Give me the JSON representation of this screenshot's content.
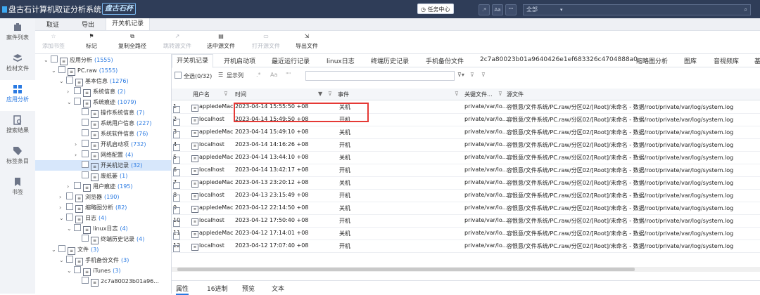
{
  "window": {
    "title": "盘古石计算机取证分析系统",
    "brand": "盘古石杯",
    "task_center": "任务中心",
    "regex_btn": ".*",
    "case_btn": "Aa",
    "word_btn": "\"\"",
    "scope": "全部",
    "search_icon": "search-icon"
  },
  "sidebar": {
    "items": [
      {
        "label": "案件列表",
        "icon": "case-icon"
      },
      {
        "label": "检材文件",
        "icon": "layers-icon"
      },
      {
        "label": "应用分析",
        "icon": "apps-icon",
        "active": true
      },
      {
        "label": "搜索结果",
        "icon": "search-result-icon"
      },
      {
        "label": "标签条目",
        "icon": "tag-icon"
      },
      {
        "label": "书签",
        "icon": "bookmark-icon"
      }
    ]
  },
  "top_tabs": [
    "取证",
    "导出",
    "开关机记录"
  ],
  "toolbar": {
    "items": [
      {
        "label": "添加书签",
        "disabled": true
      },
      {
        "label": "标记",
        "disabled": false
      },
      {
        "label": "复制全路径",
        "disabled": false
      },
      {
        "label": "跳转源文件",
        "disabled": true
      },
      {
        "label": "选中源文件",
        "disabled": false
      },
      {
        "label": "打开源文件",
        "disabled": true
      },
      {
        "label": "导出文件",
        "disabled": false
      }
    ]
  },
  "tree": {
    "rows": [
      {
        "label": "应用分析",
        "count": "(1555)",
        "indent": 0,
        "exp": "v"
      },
      {
        "label": "PC.raw",
        "count": "(1555)",
        "indent": 1,
        "exp": "v"
      },
      {
        "label": "基本信息",
        "count": "(1276)",
        "indent": 2,
        "exp": "v"
      },
      {
        "label": "系统信息",
        "count": "(2)",
        "indent": 3,
        "exp": ">"
      },
      {
        "label": "系统痕迹",
        "count": "(1079)",
        "indent": 3,
        "exp": "v"
      },
      {
        "label": "操作系统信息",
        "count": "(7)",
        "indent": 4,
        "exp": ""
      },
      {
        "label": "系统用户信息",
        "count": "(227)",
        "indent": 4,
        "exp": ""
      },
      {
        "label": "系统软件信息",
        "count": "(76)",
        "indent": 4,
        "exp": ""
      },
      {
        "label": "开机启动项",
        "count": "(732)",
        "indent": 4,
        "exp": ">"
      },
      {
        "label": "网络配置",
        "count": "(4)",
        "indent": 4,
        "exp": ">"
      },
      {
        "label": "开关机记录",
        "count": "(32)",
        "indent": 4,
        "exp": "",
        "selected": true
      },
      {
        "label": "废纸篓",
        "count": "(1)",
        "indent": 4,
        "exp": ""
      },
      {
        "label": "用户痕迹",
        "count": "(195)",
        "indent": 3,
        "exp": ">"
      },
      {
        "label": "浏览器",
        "count": "(190)",
        "indent": 2,
        "exp": ">"
      },
      {
        "label": "缩略图分析",
        "count": "(82)",
        "indent": 2,
        "exp": ">"
      },
      {
        "label": "日志",
        "count": "(4)",
        "indent": 2,
        "exp": "v"
      },
      {
        "label": "linux日志",
        "count": "(4)",
        "indent": 3,
        "exp": "v"
      },
      {
        "label": "终端历史记录",
        "count": "(4)",
        "indent": 4,
        "exp": ""
      },
      {
        "label": "文件",
        "count": "(3)",
        "indent": 1,
        "exp": "v"
      },
      {
        "label": "手机备份文件",
        "count": "(3)",
        "indent": 2,
        "exp": "v"
      },
      {
        "label": "iTunes",
        "count": "(3)",
        "indent": 3,
        "exp": "v"
      },
      {
        "label": "2c7a80023b01a96...",
        "count": "",
        "indent": 4,
        "exp": ""
      }
    ]
  },
  "result_tabs": [
    "开关机记录",
    "开机启动项",
    "最近运行记录",
    "linux日志",
    "终端历史记录",
    "手机备份文件",
    "2c7a80023b01a9640426e1ef683326c4704888a0",
    "缩略图分析",
    "图库",
    "音视频库",
    "基"
  ],
  "filter": {
    "select_all": "全选(0/32)",
    "show_columns": "显示列",
    "regex": ".*",
    "case": "Aa",
    "word": "\"\""
  },
  "grid": {
    "columns": [
      "用户名",
      "时间",
      "事件",
      "关键文件...",
      "源文件"
    ],
    "rows": [
      {
        "n": "1",
        "user": "appledeMac",
        "time": "2023-04-14 15:55:50 +08",
        "event": "关机",
        "key": "private/var/lo...",
        "src": "容恨意/文件系统/PC.raw/分区02/[Root]/未命名 - 数据/root/private/var/log/system.log"
      },
      {
        "n": "2",
        "user": "localhost",
        "time": "2023-04-14 15:49:50 +08",
        "event": "开机",
        "key": "private/var/lo...",
        "src": "容恨意/文件系统/PC.raw/分区02/[Root]/未命名 - 数据/root/private/var/log/system.log"
      },
      {
        "n": "3",
        "user": "appledeMac",
        "time": "2023-04-14 15:49:10 +08",
        "event": "关机",
        "key": "private/var/lo...",
        "src": "容恨意/文件系统/PC.raw/分区02/[Root]/未命名 - 数据/root/private/var/log/system.log"
      },
      {
        "n": "4",
        "user": "localhost",
        "time": "2023-04-14 14:16:26 +08",
        "event": "开机",
        "key": "private/var/lo...",
        "src": "容恨意/文件系统/PC.raw/分区02/[Root]/未命名 - 数据/root/private/var/log/system.log"
      },
      {
        "n": "5",
        "user": "appledeMac",
        "time": "2023-04-14 13:44:10 +08",
        "event": "关机",
        "key": "private/var/lo...",
        "src": "容恨意/文件系统/PC.raw/分区02/[Root]/未命名 - 数据/root/private/var/log/system.log"
      },
      {
        "n": "6",
        "user": "localhost",
        "time": "2023-04-14 13:42:17 +08",
        "event": "开机",
        "key": "private/var/lo...",
        "src": "容恨意/文件系统/PC.raw/分区02/[Root]/未命名 - 数据/root/private/var/log/system.log"
      },
      {
        "n": "7",
        "user": "appledeMac",
        "time": "2023-04-13 23:20:12 +08",
        "event": "关机",
        "key": "private/var/lo...",
        "src": "容恨意/文件系统/PC.raw/分区02/[Root]/未命名 - 数据/root/private/var/log/system.log"
      },
      {
        "n": "8",
        "user": "localhost",
        "time": "2023-04-13 23:15:49 +08",
        "event": "开机",
        "key": "private/var/lo...",
        "src": "容恨意/文件系统/PC.raw/分区02/[Root]/未命名 - 数据/root/private/var/log/system.log"
      },
      {
        "n": "9",
        "user": "appledeMac",
        "time": "2023-04-12 22:14:50 +08",
        "event": "关机",
        "key": "private/var/lo...",
        "src": "容恨意/文件系统/PC.raw/分区02/[Root]/未命名 - 数据/root/private/var/log/system.log"
      },
      {
        "n": "10",
        "user": "localhost",
        "time": "2023-04-12 17:50:40 +08",
        "event": "开机",
        "key": "private/var/lo...",
        "src": "容恨意/文件系统/PC.raw/分区02/[Root]/未命名 - 数据/root/private/var/log/system.log"
      },
      {
        "n": "11",
        "user": "appledeMac",
        "time": "2023-04-12 17:14:01 +08",
        "event": "关机",
        "key": "private/var/lo...",
        "src": "容恨意/文件系统/PC.raw/分区02/[Root]/未命名 - 数据/root/private/var/log/system.log"
      },
      {
        "n": "12",
        "user": "localhost",
        "time": "2023-04-12 17:07:40 +08",
        "event": "开机",
        "key": "private/var/lo...",
        "src": "容恨意/文件系统/PC.raw/分区02/[Root]/未命名 - 数据/root/private/var/log/system.log"
      }
    ]
  },
  "bottom_tabs": [
    "属性",
    "16进制",
    "预览",
    "文本"
  ],
  "colors": {
    "titlebar": "#2f3d58",
    "accent": "#2a7ae2",
    "highlight": "#e53935",
    "selected": "#d7e7fb"
  }
}
